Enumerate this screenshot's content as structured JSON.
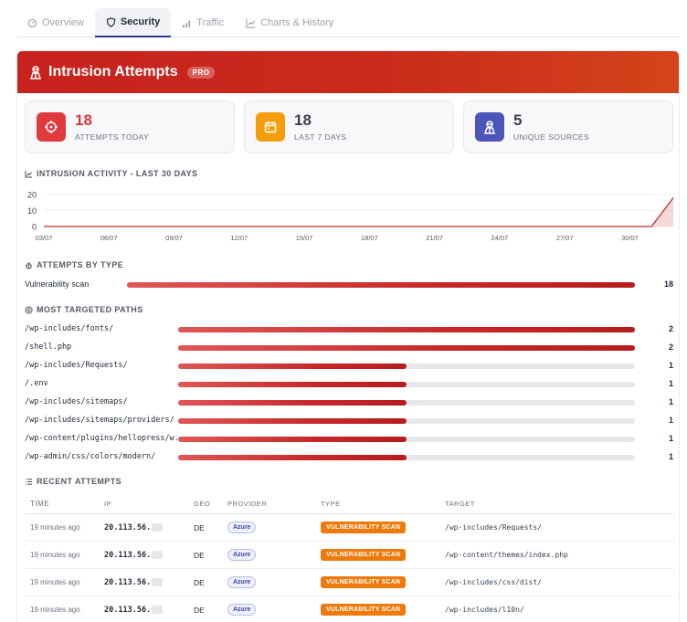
{
  "tabs": [
    {
      "label": "Overview",
      "icon": "gauge-icon"
    },
    {
      "label": "Security",
      "icon": "shield-icon",
      "active": true
    },
    {
      "label": "Traffic",
      "icon": "signal-icon"
    },
    {
      "label": "Charts & History",
      "icon": "line-chart-icon"
    }
  ],
  "banner": {
    "title": "Intrusion Attempts",
    "badge": "PRO",
    "icon": "intruder-icon"
  },
  "stats": [
    {
      "value": "18",
      "label": "ATTEMPTS TODAY",
      "color": "#e0393e",
      "icon": "crosshair-icon"
    },
    {
      "value": "18",
      "label": "LAST 7 DAYS",
      "color": "#f59e0b",
      "icon": "calendar-icon"
    },
    {
      "value": "5",
      "label": "UNIQUE SOURCES",
      "color": "#4c56b8",
      "icon": "intruder-icon"
    }
  ],
  "activity": {
    "title": "INTRUSION ACTIVITY - LAST 30 DAYS"
  },
  "chart_data": {
    "type": "area",
    "x": [
      "03/07",
      "04/07",
      "05/07",
      "06/07",
      "07/07",
      "08/07",
      "09/07",
      "10/07",
      "11/07",
      "12/07",
      "13/07",
      "14/07",
      "15/07",
      "16/07",
      "17/07",
      "18/07",
      "19/07",
      "20/07",
      "21/07",
      "22/07",
      "23/07",
      "24/07",
      "25/07",
      "26/07",
      "27/07",
      "28/07",
      "29/07",
      "30/07",
      "31/07",
      "01/08"
    ],
    "tick_labels": [
      "03/07",
      "06/07",
      "09/07",
      "12/07",
      "15/07",
      "18/07",
      "21/07",
      "24/07",
      "27/07",
      "30/07"
    ],
    "values": [
      0,
      0,
      0,
      0,
      0,
      0,
      0,
      0,
      0,
      0,
      0,
      0,
      0,
      0,
      0,
      0,
      0,
      0,
      0,
      0,
      0,
      0,
      0,
      0,
      0,
      0,
      0,
      0,
      0,
      18
    ],
    "yticks": [
      "20",
      "10",
      "0"
    ],
    "ylim": [
      0,
      20
    ],
    "color": "#c62828"
  },
  "types": {
    "title": "ATTEMPTS BY TYPE",
    "items": [
      {
        "label": "Vulnerability scan",
        "count": "18",
        "value": 18,
        "max": 18
      }
    ]
  },
  "paths": {
    "title": "MOST TARGETED PATHS",
    "items": [
      {
        "label": "/wp-includes/fonts/",
        "count": "2",
        "value": 2
      },
      {
        "label": "/shell.php",
        "count": "2",
        "value": 2
      },
      {
        "label": "/wp-includes/Requests/",
        "count": "1",
        "value": 1
      },
      {
        "label": "/.env",
        "count": "1",
        "value": 1
      },
      {
        "label": "/wp-includes/sitemaps/",
        "count": "1",
        "value": 1
      },
      {
        "label": "/wp-includes/sitemaps/providers/",
        "count": "1",
        "value": 1
      },
      {
        "label": "/wp-content/plugins/hellopress/w...",
        "count": "1",
        "value": 1
      },
      {
        "label": "/wp-admin/css/colors/modern/",
        "count": "1",
        "value": 1
      }
    ],
    "max": 2
  },
  "recent": {
    "title": "RECENT ATTEMPTS",
    "headers": [
      "TIME",
      "IP",
      "GEO",
      "PROVIDER",
      "TYPE",
      "TARGET"
    ],
    "rows": [
      {
        "time": "19 minutes ago",
        "ip": "20.113.56.",
        "geo": "DE",
        "provider": "Azure",
        "type": "VULNERABILITY SCAN",
        "target": "/wp-includes/Requests/"
      },
      {
        "time": "19 minutes ago",
        "ip": "20.113.56.",
        "geo": "DE",
        "provider": "Azure",
        "type": "VULNERABILITY SCAN",
        "target": "/wp-content/themes/index.php"
      },
      {
        "time": "19 minutes ago",
        "ip": "20.113.56.",
        "geo": "DE",
        "provider": "Azure",
        "type": "VULNERABILITY SCAN",
        "target": "/wp-includes/css/dist/"
      },
      {
        "time": "19 minutes ago",
        "ip": "20.113.56.",
        "geo": "DE",
        "provider": "Azure",
        "type": "VULNERABILITY SCAN",
        "target": "/wp-includes/l10n/"
      }
    ]
  }
}
